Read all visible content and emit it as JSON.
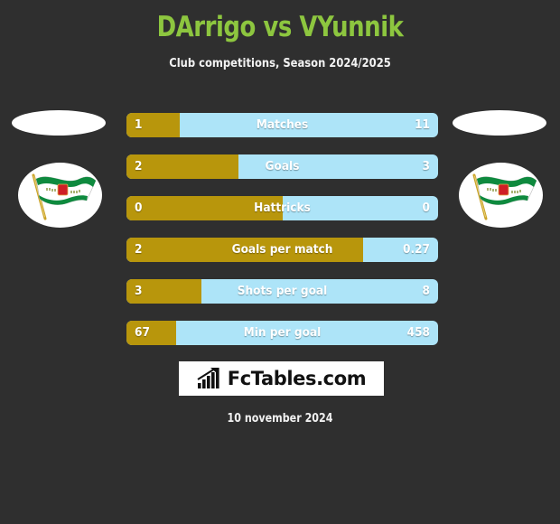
{
  "header": {
    "title": "DArrigo vs VYunnik",
    "subtitle": "Club competitions, Season 2024/2025",
    "title_color": "#8dc63f",
    "subtitle_color": "#f2f2f2"
  },
  "background_color": "#2f2f2f",
  "crests": {
    "left": {
      "blank_oval": "",
      "flag_name": "pennant-flag-green-white-red"
    },
    "right": {
      "blank_oval": "",
      "flag_name": "pennant-flag-green-white-red"
    }
  },
  "chart_data": {
    "type": "bar",
    "title": "DArrigo vs VYunnik",
    "subtitle": "Club competitions, Season 2024/2025",
    "orientation": "horizontal-diverging",
    "home_color": "#b8960c",
    "away_color": "#ade4f8",
    "categories": [
      "Matches",
      "Goals",
      "Hattricks",
      "Goals per match",
      "Shots per goal",
      "Min per goal"
    ],
    "series": [
      {
        "name": "DArrigo",
        "values": [
          "1",
          "2",
          "0",
          "2",
          "3",
          "67"
        ]
      },
      {
        "name": "VYunnik",
        "values": [
          "11",
          "3",
          "0",
          "0.27",
          "8",
          "458"
        ]
      }
    ],
    "fill_percents": [
      17,
      36,
      50,
      76,
      24,
      16
    ]
  },
  "stats": [
    {
      "label": "Matches",
      "home": "1",
      "away": "11",
      "fill": 17
    },
    {
      "label": "Goals",
      "home": "2",
      "away": "3",
      "fill": 36
    },
    {
      "label": "Hattricks",
      "home": "0",
      "away": "0",
      "fill": 50
    },
    {
      "label": "Goals per match",
      "home": "2",
      "away": "0.27",
      "fill": 76
    },
    {
      "label": "Shots per goal",
      "home": "3",
      "away": "8",
      "fill": 24
    },
    {
      "label": "Min per goal",
      "home": "67",
      "away": "458",
      "fill": 16
    }
  ],
  "logo": {
    "text": "FcTables.com",
    "icon": "bar-chart-trend-icon"
  },
  "footer": {
    "date": "10 november 2024"
  }
}
